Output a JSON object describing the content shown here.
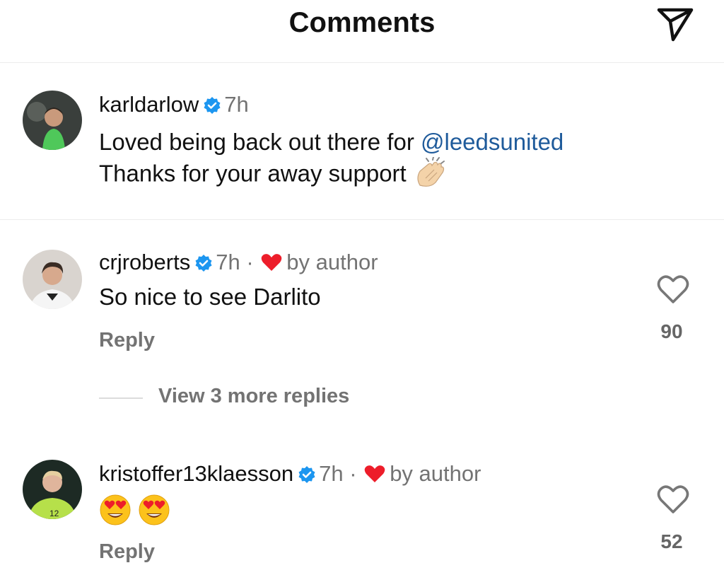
{
  "header": {
    "title": "Comments",
    "share_icon": "paper-plane-icon"
  },
  "comments": [
    {
      "username": "karldarlow",
      "verified": true,
      "time": "7h",
      "text_line1_prefix": "Loved being back out there for ",
      "mention": "@leedsunited",
      "text_line2": "Thanks for your away support",
      "emoji": "clapping-hands-emoji"
    },
    {
      "username": "crjroberts",
      "verified": true,
      "time": "7h",
      "separator": "·",
      "liked_by": "by author",
      "text": "So nice to see Darlito",
      "reply_label": "Reply",
      "likes": "90"
    },
    {
      "username": "kristoffer13klaesson",
      "verified": true,
      "time": "7h",
      "separator": "·",
      "liked_by": "by author",
      "emojis": [
        "heart-eyes-emoji",
        "heart-eyes-emoji"
      ],
      "reply_label": "Reply",
      "likes": "52"
    }
  ],
  "view_more": "View 3 more replies",
  "colors": {
    "accent_link": "#1f5b9b",
    "verified_blue": "#1c96f0",
    "heart_red": "#ed1d2a",
    "muted": "#737373"
  }
}
